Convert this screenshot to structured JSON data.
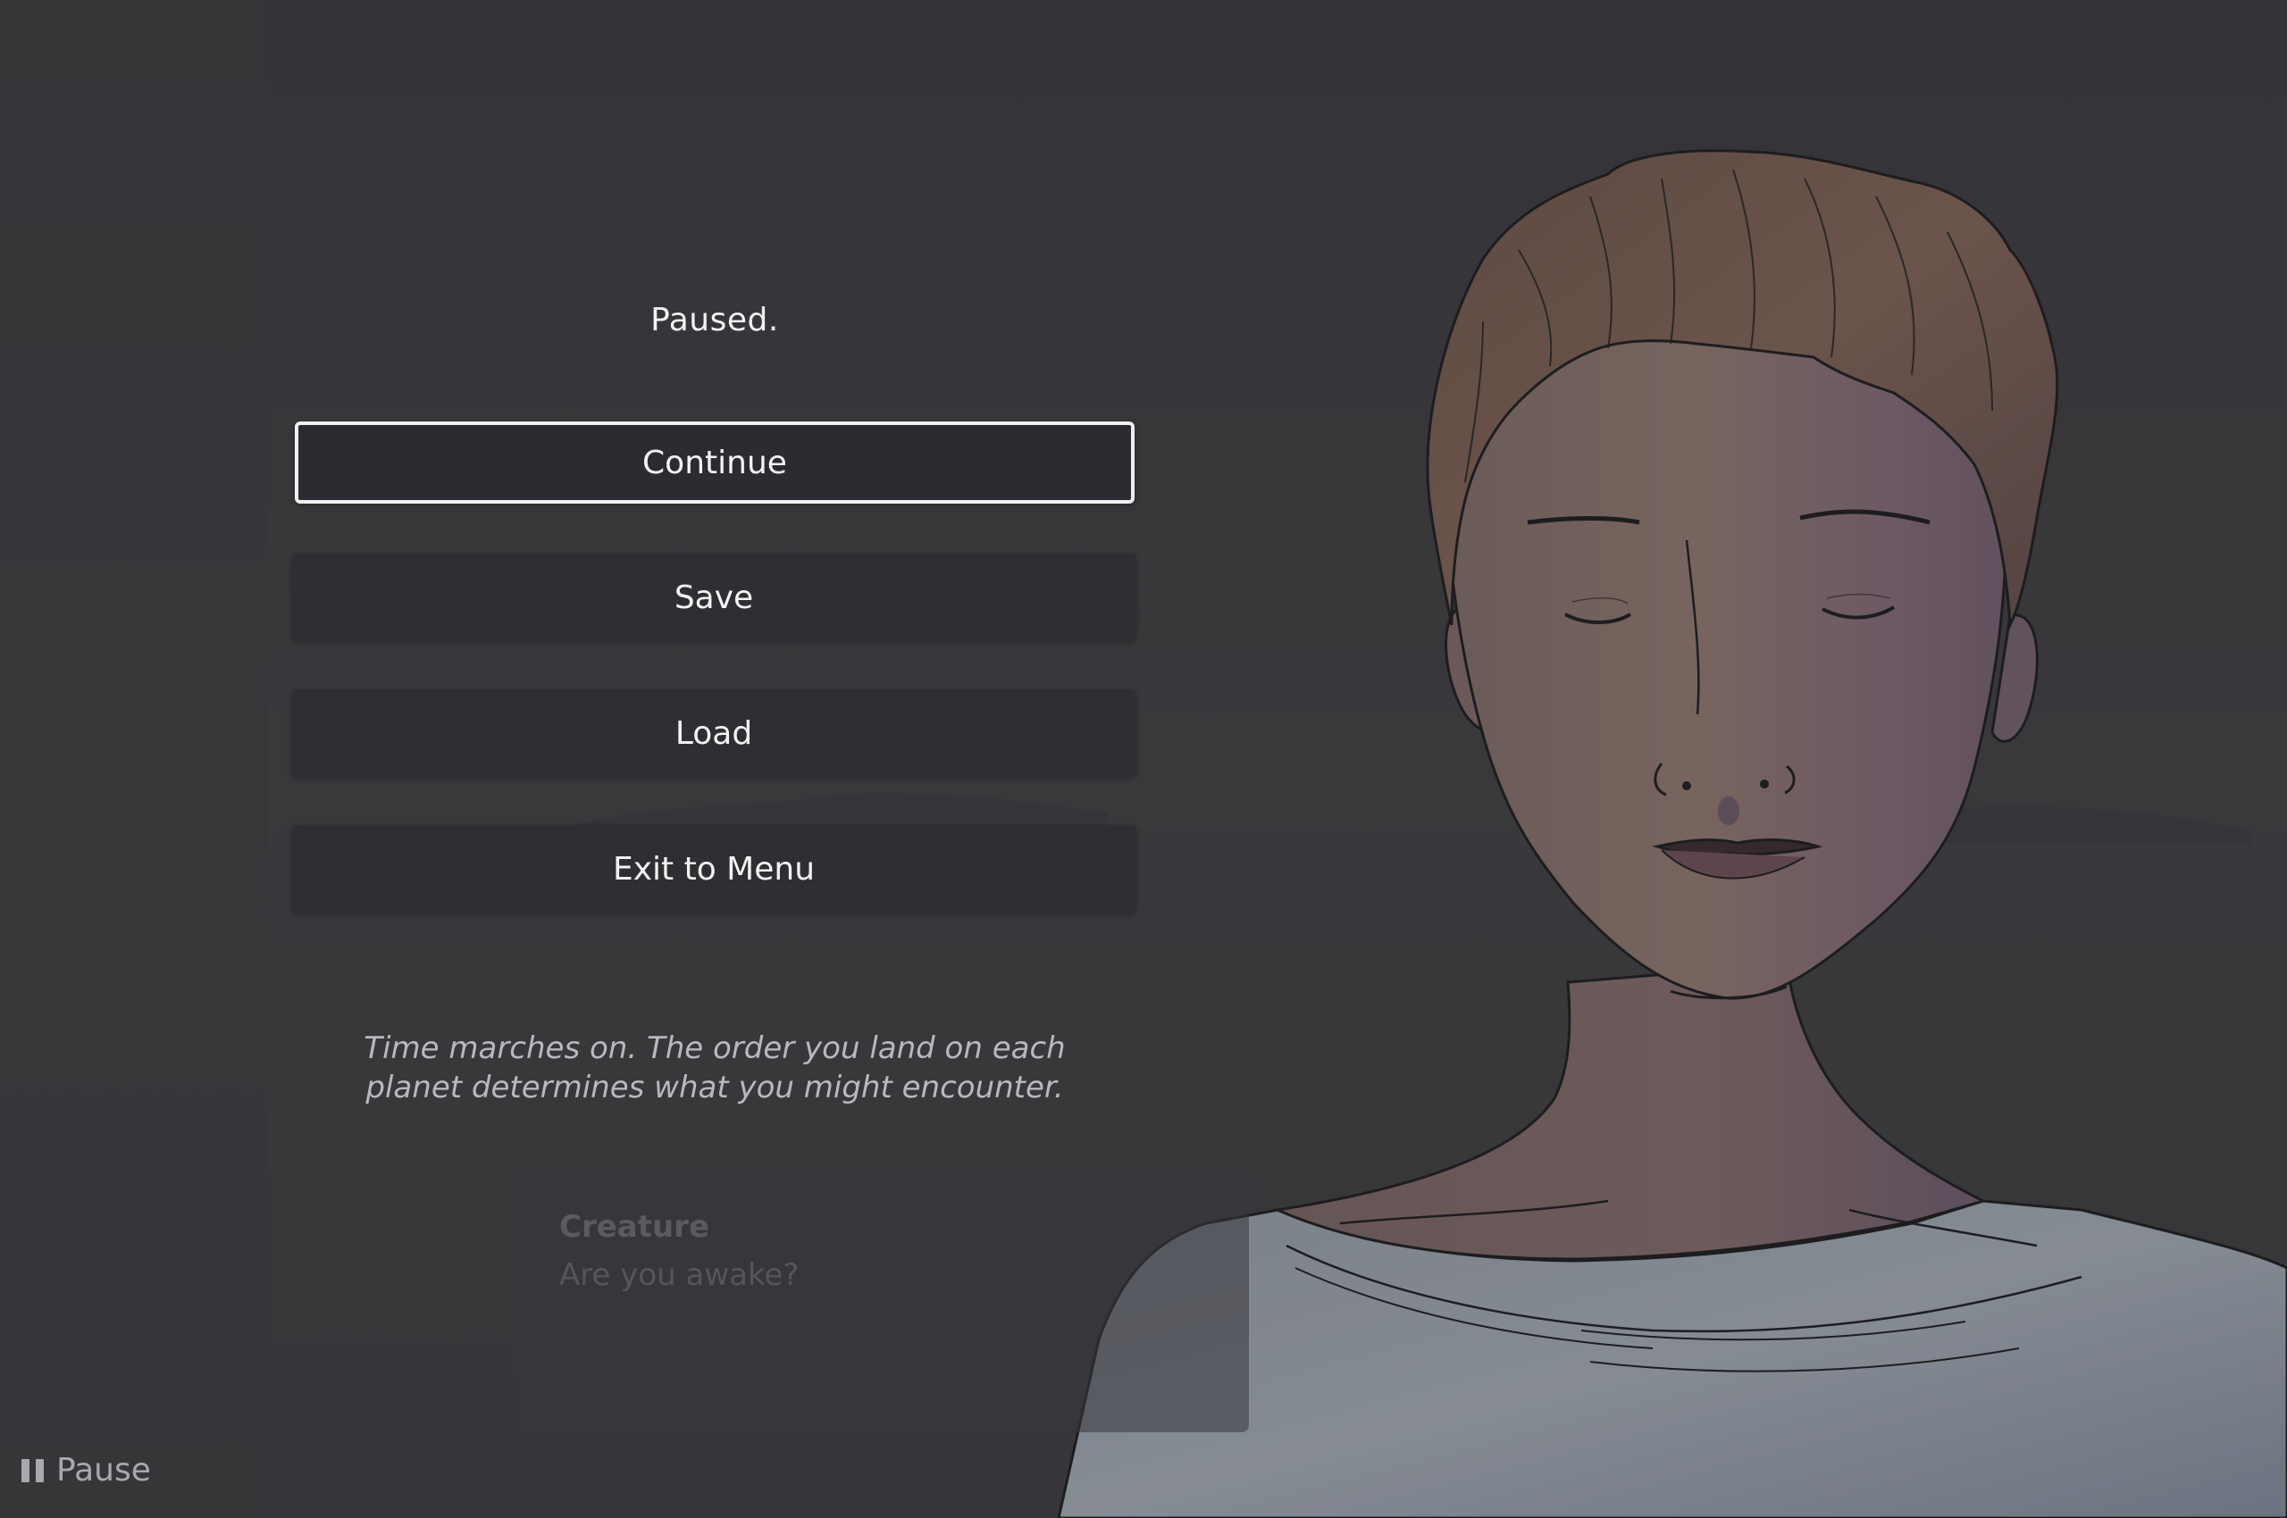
{
  "menu": {
    "title": "Paused.",
    "buttons": [
      {
        "label": "Continue",
        "selected": true
      },
      {
        "label": "Save",
        "selected": false
      },
      {
        "label": "Load",
        "selected": false
      },
      {
        "label": "Exit to Menu",
        "selected": false
      }
    ],
    "hint": "Time marches on. The order you land on each planet determines what you might encounter."
  },
  "dialog": {
    "speaker": "Creature",
    "line": "Are you awake?"
  },
  "status": {
    "pause_label": "Pause",
    "pause_icon": "pause-icon"
  },
  "colors": {
    "background": "#3b3b3d",
    "button_bg": "#2e2e32",
    "selected_border": "#f0f0f0",
    "text": "#f4f4f4",
    "hint_text": "#b9b9bd"
  }
}
